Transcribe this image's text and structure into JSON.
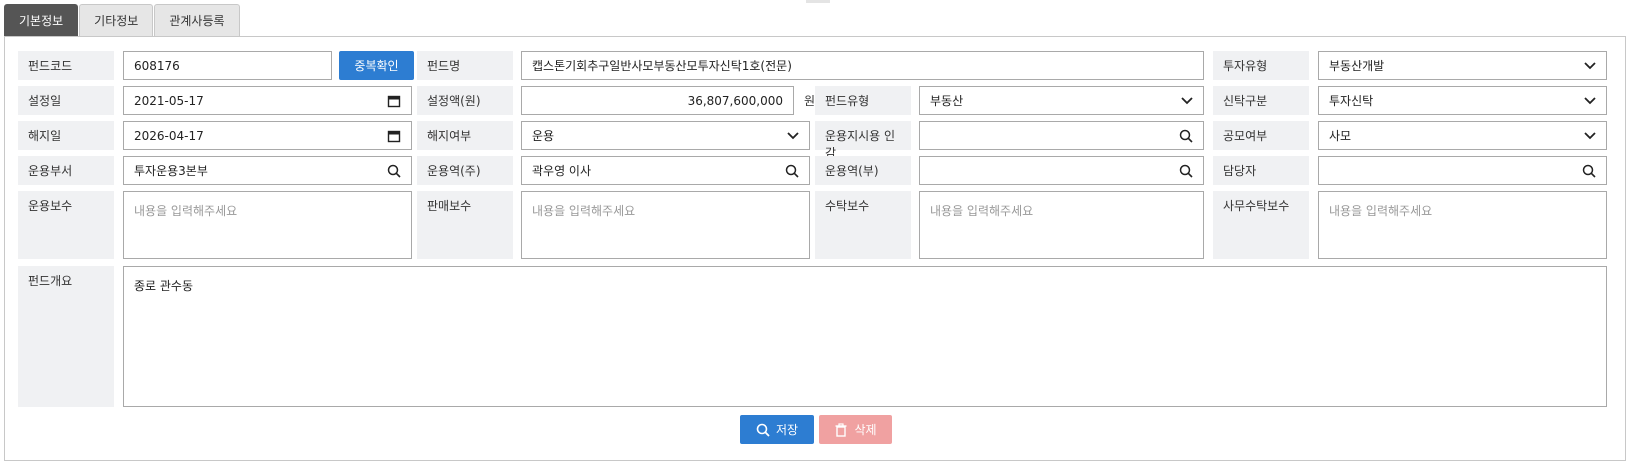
{
  "tabs": [
    "기본정보",
    "기타정보",
    "관계사등록"
  ],
  "labels": {
    "fund_code": "펀드코드",
    "fund_name": "펀드명",
    "invest_type": "투자유형",
    "setup_date": "설정일",
    "setup_amount": "설정액(원)",
    "fund_type": "펀드유형",
    "trust_type": "신탁구분",
    "end_date": "해지일",
    "end_status": "해지여부",
    "seal": "운용지시용 인감",
    "public_private": "공모여부",
    "dept": "운용부서",
    "manager_main": "운용역(주)",
    "manager_sub": "운용역(부)",
    "person": "담당자",
    "mgmt_fee": "운용보수",
    "sales_fee": "판매보수",
    "trust_fee": "수탁보수",
    "admin_fee": "사무수탁보수",
    "overview": "펀드개요"
  },
  "values": {
    "fund_code": "608176",
    "fund_name": "캡스톤기회추구일반사모부동산모투자신탁1호(전문)",
    "invest_type": "부동산개발",
    "setup_date": "2021-05-17",
    "setup_amount": "36,807,600,000",
    "setup_amount_unit": "원",
    "fund_type": "부동산",
    "trust_type": "투자신탁",
    "end_date": "2026-04-17",
    "end_status": "운용",
    "seal": "",
    "public_private": "사모",
    "dept": "투자운용3본부",
    "manager_main": "곽우영 이사",
    "manager_sub": "",
    "person": "",
    "overview": "종로 관수동"
  },
  "placeholders": {
    "textarea": "내용을 입력해주세요"
  },
  "buttons": {
    "dup_check": "중복확인",
    "save": "저장",
    "delete": "삭제"
  },
  "colors": {
    "primary": "#2d7dd2",
    "delete": "#f0a1a1",
    "label_bg": "#f0f1f3",
    "active_tab": "#555555"
  }
}
